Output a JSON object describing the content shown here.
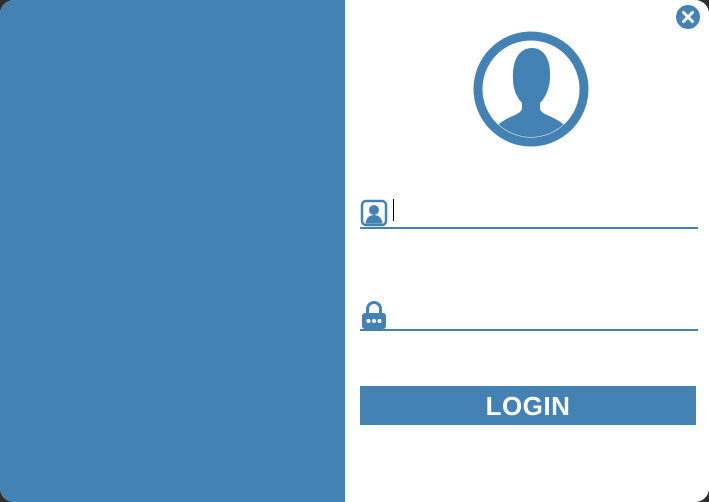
{
  "window": {
    "accent_color": "#4582b4",
    "background_color": "#ffffff"
  },
  "header": {
    "close_icon": "close-icon"
  },
  "avatar": {
    "icon": "user-avatar-icon"
  },
  "form": {
    "username": {
      "icon": "user-icon",
      "value": "",
      "placeholder": ""
    },
    "password": {
      "icon": "lock-icon",
      "value": "",
      "placeholder": ""
    },
    "login_label": "LOGIN"
  }
}
